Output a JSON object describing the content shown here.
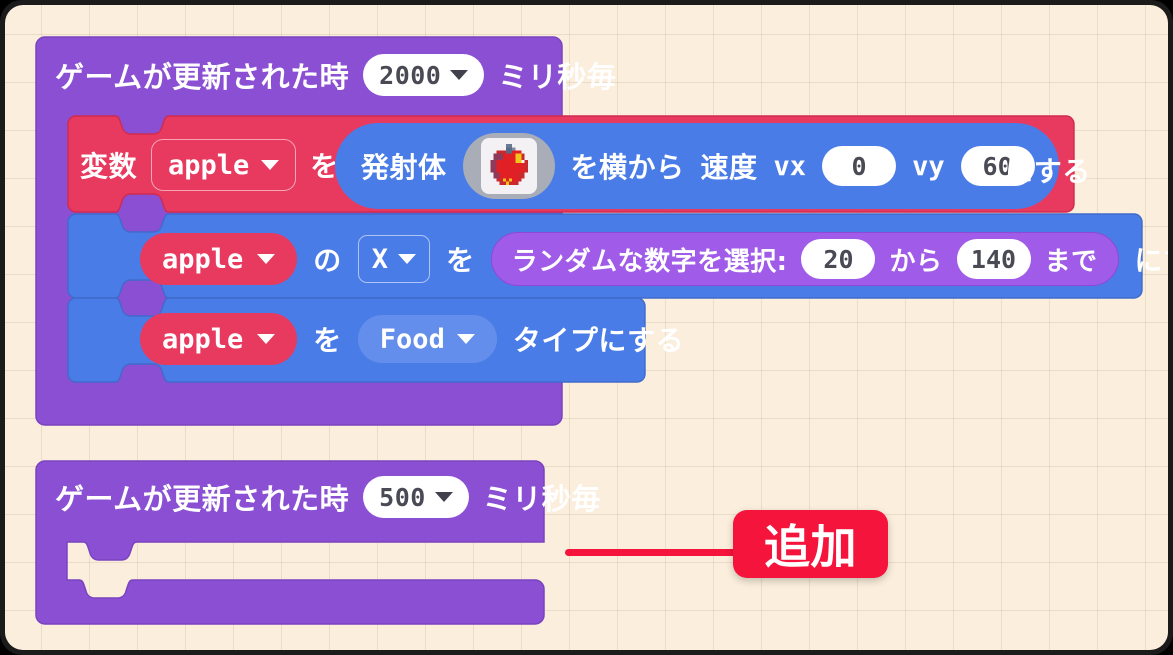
{
  "workspace": {
    "background_color": "#fbeedc",
    "grid_color": "#b8a488",
    "frame_color": "#1b1b1b"
  },
  "palette": {
    "event_purple": "#8a4fd3",
    "variable_red": "#e8395e",
    "sprite_blue": "#4a7ce8",
    "math_purple": "#a05ce8",
    "callout_red": "#f5143c"
  },
  "scripts": [
    {
      "id": "script-1",
      "hat": {
        "text_before": "ゲームが更新された時",
        "interval_value": "2000",
        "text_after": "ミリ秒毎"
      },
      "body": [
        {
          "id": "set-projectile",
          "kind": "variable-set",
          "color": "#e8395e",
          "label_set": "変数",
          "variable": "apple",
          "label_wo": "を",
          "reporter": {
            "kind": "projectile-reporter",
            "color": "#4a7ce8",
            "label_projectile": "発射体",
            "sprite": "apple-sprite-icon",
            "label_side": "を横から",
            "label_speed": "速度",
            "label_vx": "vx",
            "vx": "0",
            "label_vy": "vy",
            "vy": "60"
          },
          "label_suffix": "にする"
        },
        {
          "id": "set-x-random",
          "kind": "sprite-property-set",
          "color": "#4a7ce8",
          "variable": "apple",
          "label_no": "の",
          "property": "X",
          "label_wo": "を",
          "reporter": {
            "kind": "pick-random",
            "color": "#a05ce8",
            "label": "ランダムな数字を選択:",
            "min": "20",
            "label_kara": "から",
            "max": "140",
            "label_made": "まで"
          },
          "label_suffix": "にする"
        },
        {
          "id": "set-kind",
          "kind": "sprite-kind-set",
          "color": "#4a7ce8",
          "variable": "apple",
          "label_wo": "を",
          "kind_value": "Food",
          "label_suffix": "タイプにする"
        }
      ]
    },
    {
      "id": "script-2",
      "hat": {
        "text_before": "ゲームが更新された時",
        "interval_value": "500",
        "text_after": "ミリ秒毎"
      },
      "body": []
    }
  ],
  "annotation": {
    "label": "追加",
    "color": "#f5143c",
    "has_leader_line": true
  }
}
